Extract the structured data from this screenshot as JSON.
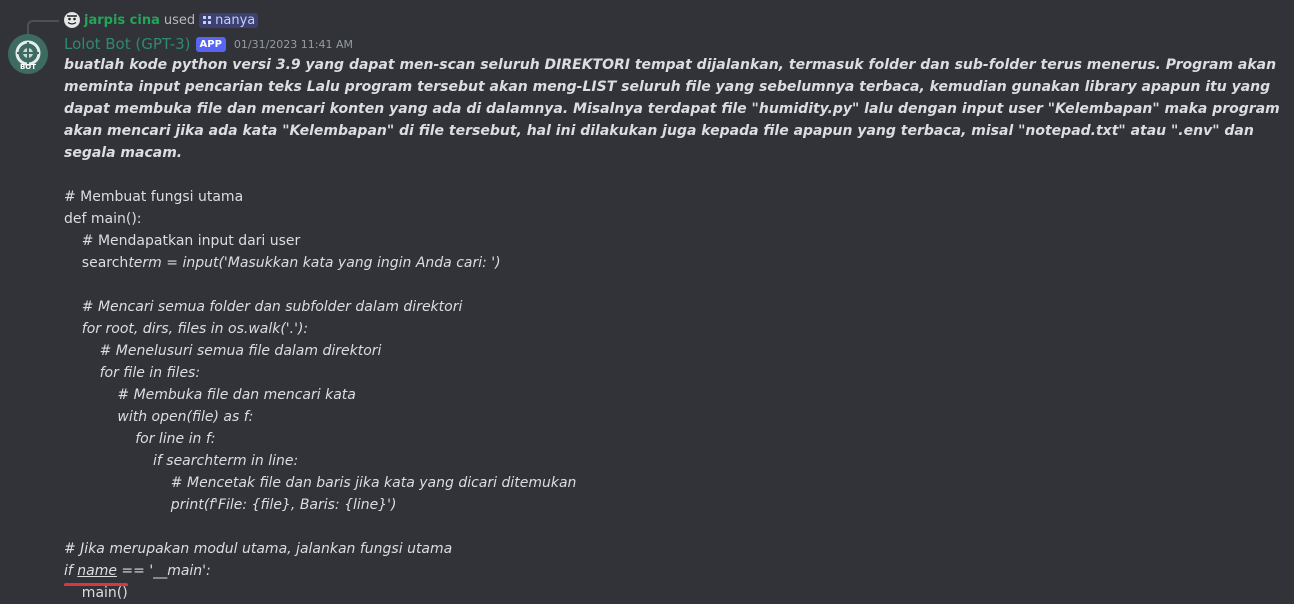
{
  "reply": {
    "user": "jarpis cina",
    "used_text": "used",
    "command": "nanya"
  },
  "message": {
    "author": "Lolot Bot (GPT-3)",
    "app_tag": "APP",
    "timestamp": "01/31/2023 11:41 AM",
    "avatar_label": "BOT",
    "prompt": "buatlah kode python versi 3.9 yang dapat men-scan seluruh DIREKTORI tempat dijalankan, termasuk folder dan sub-folder terus menerus. Program akan meminta input pencarian teks Lalu program tersebut akan meng-LIST seluruh file yang sebelumnya terbaca, kemudian gunakan library apapun itu yang dapat membuka file dan mencari konten yang ada di dalamnya. Misalnya terdapat file \"humidity.py\" lalu dengan input user \"Kelembapan\" maka program akan mencari jika ada kata \"Kelembapan\" di file tersebut, hal ini dilakukan juga kepada file apapun yang terbaca, misal \"notepad.txt\" atau \".env\" dan segala macam.",
    "code": {
      "l1": "# Membuat fungsi utama",
      "l2": "def main():",
      "l3": "    # Mendapatkan input dari user",
      "l4a": "    search",
      "l4b": "term = input('Masukkan kata yang ingin Anda cari: ')",
      "l6": "    # Mencari semua folder dan subfolder dalam direktori",
      "l7": "    for root, dirs, files in os.walk('.'):",
      "l8": "        # Menelusuri semua file dalam direktori",
      "l9": "        for file in files:",
      "l10": "            # Membuka file dan mencari kata",
      "l11": "            with open(file) as f:",
      "l12": "                for line in f:",
      "l13": "                    if searchterm in line:",
      "l14": "                        # Mencetak file dan baris jika kata yang dicari ditemukan",
      "l15": "                        print(f'File: {file}, Baris: {line}')",
      "l17": "# Jika merupakan modul utama, jalankan fungsi utama",
      "l18a": "if ",
      "l18b": "name",
      "l18c": " == '__main':",
      "l19": "    main()"
    }
  },
  "colors": {
    "background": "#313338",
    "bot_name": "#2f8a6f",
    "reply_name": "#23a559",
    "app_tag": "#5865f2"
  }
}
